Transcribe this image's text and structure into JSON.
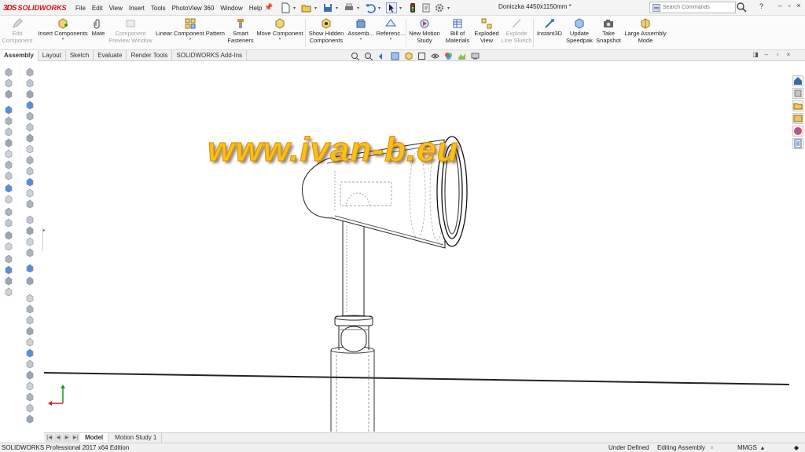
{
  "app": {
    "logo_text": "SOLIDWORKS",
    "logo_mark": "3DS",
    "document_title": "Doniczka 4450x1150mm *"
  },
  "menu": [
    "File",
    "Edit",
    "View",
    "Insert",
    "Tools",
    "PhotoView 360",
    "Window",
    "Help"
  ],
  "search": {
    "placeholder": "Search Commands"
  },
  "help_label": "?",
  "commands": {
    "edit_component": "Edit Component",
    "insert_components": "Insert Components",
    "mate": "Mate",
    "component_preview": "Component Preview Window",
    "linear_pattern": "Linear Component Pattern",
    "smart_fasteners": "Smart Fasteners",
    "move_component": "Move Component",
    "show_hidden": "Show Hidden Components",
    "assembly_features": "Assemb...",
    "reference_geometry": "Referenc...",
    "new_motion_study": "New Motion Study",
    "bill_of_materials": "Bill of Materials",
    "exploded_view": "Exploded View",
    "explode_line_sketch": "Explode Line Sketch",
    "instant3d": "Instant3D",
    "update_speedpak": "Update Speedpak",
    "take_snapshot": "Take Snapshot",
    "large_assembly_mode": "Large Assembly Mode"
  },
  "tabs": [
    "Assembly",
    "Layout",
    "Sketch",
    "Evaluate",
    "Render Tools",
    "SOLIDWORKS Add-Ins"
  ],
  "watermark": "www.ivan-b.eu",
  "bottom_tabs": [
    "Model",
    "Motion Study 1"
  ],
  "status": {
    "edition": "SOLIDWORKS Professional 2017 x64 Edition",
    "definition": "Under Defined",
    "mode": "Editing Assembly",
    "units": "MMGS"
  },
  "colors": {
    "brand_red": "#d0121b",
    "watermark_fill": "#f6c21a",
    "axis_x": "#d42020",
    "axis_y": "#1d9a1d"
  }
}
